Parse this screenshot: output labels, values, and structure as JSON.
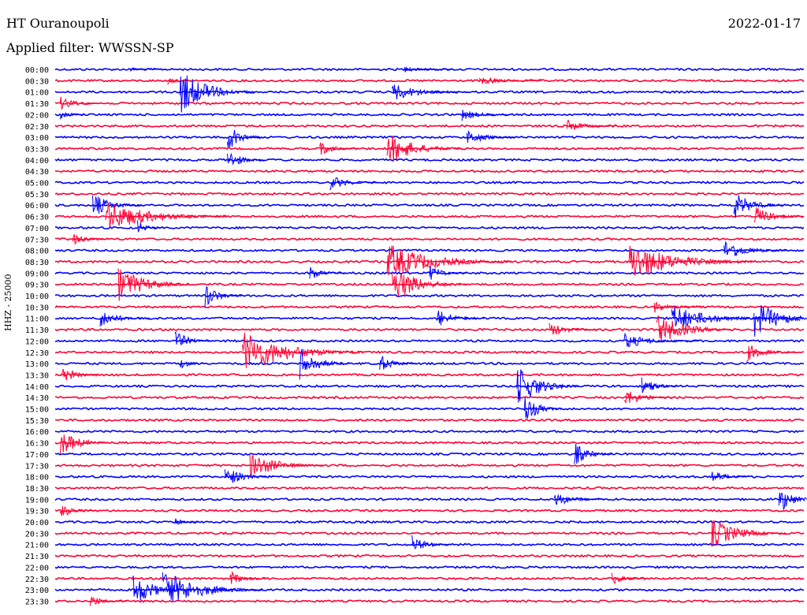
{
  "header": {
    "station": "HT Ouranoupoli",
    "date": "2022-01-17",
    "filter": "Applied filter: WWSSN-SP"
  },
  "chart_data": {
    "type": "line",
    "title": "HT Ouranoupoli",
    "ylabel": "HHZ - 25000",
    "row_labels": [
      "00:00",
      "00:30",
      "01:00",
      "01:30",
      "02:00",
      "02:30",
      "03:00",
      "03:30",
      "04:00",
      "04:30",
      "05:00",
      "05:30",
      "06:00",
      "06:30",
      "07:00",
      "07:30",
      "08:00",
      "08:30",
      "09:00",
      "09:30",
      "10:00",
      "10:30",
      "11:00",
      "11:30",
      "12:00",
      "12:30",
      "13:00",
      "13:30",
      "14:00",
      "14:30",
      "15:00",
      "15:30",
      "16:00",
      "16:30",
      "17:00",
      "17:30",
      "18:00",
      "18:30",
      "19:00",
      "19:30",
      "20:00",
      "20:30",
      "21:00",
      "21:30",
      "22:00",
      "22:30",
      "23:00",
      "23:30"
    ],
    "trace_colors": [
      "#0000ff",
      "#ff0033"
    ],
    "minutes_per_row": 30,
    "events": [
      {
        "row": 0,
        "minute": 3.0,
        "amplitude": 3,
        "duration_min": 1.5
      },
      {
        "row": 0,
        "minute": 14.0,
        "amplitude": 4,
        "duration_min": 2
      },
      {
        "row": 1,
        "minute": 4.5,
        "amplitude": 5,
        "duration_min": 1
      },
      {
        "row": 1,
        "minute": 17.0,
        "amplitude": 6,
        "duration_min": 2.5
      },
      {
        "row": 2,
        "minute": 5.0,
        "amplitude": 30,
        "duration_min": 3
      },
      {
        "row": 2,
        "minute": 13.5,
        "amplitude": 12,
        "duration_min": 3
      },
      {
        "row": 3,
        "minute": 0.2,
        "amplitude": 10,
        "duration_min": 1.5
      },
      {
        "row": 4,
        "minute": 0.2,
        "amplitude": 8,
        "duration_min": 1
      },
      {
        "row": 4,
        "minute": 16.3,
        "amplitude": 8,
        "duration_min": 2
      },
      {
        "row": 5,
        "minute": 20.5,
        "amplitude": 8,
        "duration_min": 2
      },
      {
        "row": 6,
        "minute": 6.9,
        "amplitude": 18,
        "duration_min": 1.5
      },
      {
        "row": 6,
        "minute": 16.5,
        "amplitude": 10,
        "duration_min": 2
      },
      {
        "row": 7,
        "minute": 10.6,
        "amplitude": 10,
        "duration_min": 1.5
      },
      {
        "row": 7,
        "minute": 13.3,
        "amplitude": 22,
        "duration_min": 3
      },
      {
        "row": 8,
        "minute": 6.9,
        "amplitude": 14,
        "duration_min": 1.5
      },
      {
        "row": 10,
        "minute": 11.0,
        "amplitude": 10,
        "duration_min": 2
      },
      {
        "row": 12,
        "minute": 1.5,
        "amplitude": 16,
        "duration_min": 2
      },
      {
        "row": 12,
        "minute": 27.2,
        "amplitude": 18,
        "duration_min": 2
      },
      {
        "row": 13,
        "minute": 2.0,
        "amplitude": 20,
        "duration_min": 5
      },
      {
        "row": 13,
        "minute": 28.0,
        "amplitude": 14,
        "duration_min": 2
      },
      {
        "row": 14,
        "minute": 3.3,
        "amplitude": 10,
        "duration_min": 1
      },
      {
        "row": 15,
        "minute": 0.7,
        "amplitude": 8,
        "duration_min": 1.5
      },
      {
        "row": 16,
        "minute": 26.8,
        "amplitude": 14,
        "duration_min": 2.5
      },
      {
        "row": 17,
        "minute": 13.3,
        "amplitude": 24,
        "duration_min": 5
      },
      {
        "row": 17,
        "minute": 23.0,
        "amplitude": 26,
        "duration_min": 5
      },
      {
        "row": 18,
        "minute": 10.2,
        "amplitude": 10,
        "duration_min": 1.5
      },
      {
        "row": 18,
        "minute": 15.0,
        "amplitude": 10,
        "duration_min": 1.5
      },
      {
        "row": 19,
        "minute": 2.5,
        "amplitude": 24,
        "duration_min": 3
      },
      {
        "row": 19,
        "minute": 13.5,
        "amplitude": 24,
        "duration_min": 3
      },
      {
        "row": 20,
        "minute": 6.0,
        "amplitude": 16,
        "duration_min": 1.5
      },
      {
        "row": 21,
        "minute": 24.0,
        "amplitude": 8,
        "duration_min": 2
      },
      {
        "row": 22,
        "minute": 1.8,
        "amplitude": 12,
        "duration_min": 2
      },
      {
        "row": 22,
        "minute": 15.3,
        "amplitude": 12,
        "duration_min": 2
      },
      {
        "row": 22,
        "minute": 24.7,
        "amplitude": 18,
        "duration_min": 4
      },
      {
        "row": 22,
        "minute": 28.0,
        "amplitude": 24,
        "duration_min": 3
      },
      {
        "row": 23,
        "minute": 19.8,
        "amplitude": 10,
        "duration_min": 2
      },
      {
        "row": 23,
        "minute": 24.1,
        "amplitude": 22,
        "duration_min": 3
      },
      {
        "row": 24,
        "minute": 4.8,
        "amplitude": 14,
        "duration_min": 1.5
      },
      {
        "row": 24,
        "minute": 22.8,
        "amplitude": 10,
        "duration_min": 3
      },
      {
        "row": 25,
        "minute": 7.5,
        "amplitude": 28,
        "duration_min": 5
      },
      {
        "row": 25,
        "minute": 27.7,
        "amplitude": 12,
        "duration_min": 2
      },
      {
        "row": 26,
        "minute": 9.8,
        "amplitude": 22,
        "duration_min": 2
      },
      {
        "row": 26,
        "minute": 13.0,
        "amplitude": 12,
        "duration_min": 1.5
      },
      {
        "row": 26,
        "minute": 5.0,
        "amplitude": 8,
        "duration_min": 1
      },
      {
        "row": 27,
        "minute": 0.2,
        "amplitude": 14,
        "duration_min": 1.5
      },
      {
        "row": 28,
        "minute": 18.5,
        "amplitude": 28,
        "duration_min": 2.5
      },
      {
        "row": 28,
        "minute": 23.5,
        "amplitude": 12,
        "duration_min": 1.5
      },
      {
        "row": 29,
        "minute": 22.8,
        "amplitude": 12,
        "duration_min": 2
      },
      {
        "row": 30,
        "minute": 18.8,
        "amplitude": 20,
        "duration_min": 1.5
      },
      {
        "row": 33,
        "minute": 0.2,
        "amplitude": 18,
        "duration_min": 2
      },
      {
        "row": 34,
        "minute": 20.8,
        "amplitude": 16,
        "duration_min": 1.5
      },
      {
        "row": 35,
        "minute": 7.8,
        "amplitude": 18,
        "duration_min": 3
      },
      {
        "row": 36,
        "minute": 6.8,
        "amplitude": 14,
        "duration_min": 2
      },
      {
        "row": 36,
        "minute": 26.3,
        "amplitude": 10,
        "duration_min": 1.5
      },
      {
        "row": 38,
        "minute": 20.0,
        "amplitude": 10,
        "duration_min": 2
      },
      {
        "row": 38,
        "minute": 29.0,
        "amplitude": 20,
        "duration_min": 1.5
      },
      {
        "row": 39,
        "minute": 0.2,
        "amplitude": 10,
        "duration_min": 1.5
      },
      {
        "row": 40,
        "minute": 4.8,
        "amplitude": 6,
        "duration_min": 1
      },
      {
        "row": 41,
        "minute": 26.3,
        "amplitude": 20,
        "duration_min": 3
      },
      {
        "row": 42,
        "minute": 14.3,
        "amplitude": 12,
        "duration_min": 1.5
      },
      {
        "row": 45,
        "minute": 7.0,
        "amplitude": 10,
        "duration_min": 1.5
      },
      {
        "row": 45,
        "minute": 22.3,
        "amplitude": 8,
        "duration_min": 1.5
      },
      {
        "row": 46,
        "minute": 3.1,
        "amplitude": 22,
        "duration_min": 2.5
      },
      {
        "row": 46,
        "minute": 4.3,
        "amplitude": 26,
        "duration_min": 4
      },
      {
        "row": 47,
        "minute": 1.4,
        "amplitude": 8,
        "duration_min": 1.5
      }
    ]
  }
}
